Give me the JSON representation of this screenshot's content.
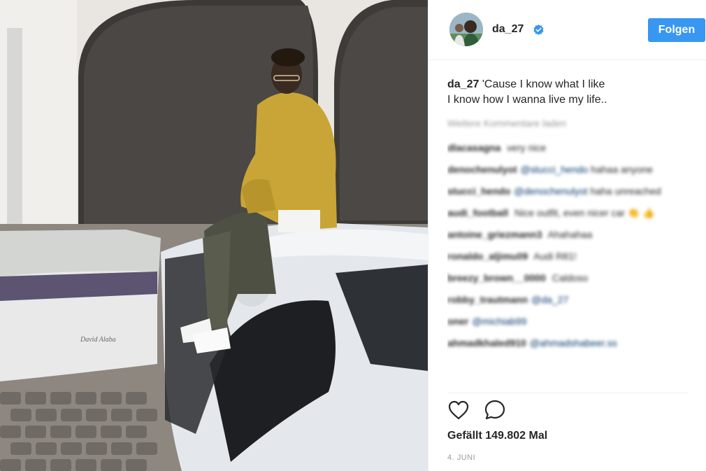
{
  "post": {
    "username": "da_27",
    "follow_label": "Folgen",
    "caption_user": "da_27",
    "caption_line1": "'Cause I know what I like",
    "caption_line2": "I know how I wanna live my life..",
    "load_more": "Weitere Kommentare laden",
    "likes": "Gefällt 149.802 Mal",
    "date": "4. JUNI"
  },
  "comments": [
    {
      "user": "dlacasagna",
      "text": "very nice",
      "mention": ""
    },
    {
      "user": "denochenulyot",
      "text": "hahaa anyone",
      "mention": "@stucci_hendo"
    },
    {
      "user": "stucci_hendo",
      "text": "haha unreached",
      "mention": "@denochenulyot"
    },
    {
      "user": "audi_football",
      "text": "Nice outfit, even nicer car 👏 👍",
      "mention": ""
    },
    {
      "user": "antoine_griezmann3",
      "text": "Ahahahaa",
      "mention": ""
    },
    {
      "user": "ronaldo_aljimu09",
      "text": "Audi R81!",
      "mention": ""
    },
    {
      "user": "breezy_brown__0000",
      "text": "Caldoso",
      "mention": ""
    },
    {
      "user": "robby_trautmann",
      "text": "",
      "mention": "@da_27"
    },
    {
      "user": "oner",
      "text": "",
      "mention": "@michiab99"
    },
    {
      "user": "ahmadkhaled910",
      "text": "",
      "mention": "@ahmadshabeer.ss"
    }
  ],
  "icons": {
    "verified": "verified-badge-icon",
    "like": "heart-icon",
    "comment": "comment-bubble-icon"
  },
  "colors": {
    "accent": "#3897f0",
    "text": "#262626",
    "muted": "#999999"
  }
}
